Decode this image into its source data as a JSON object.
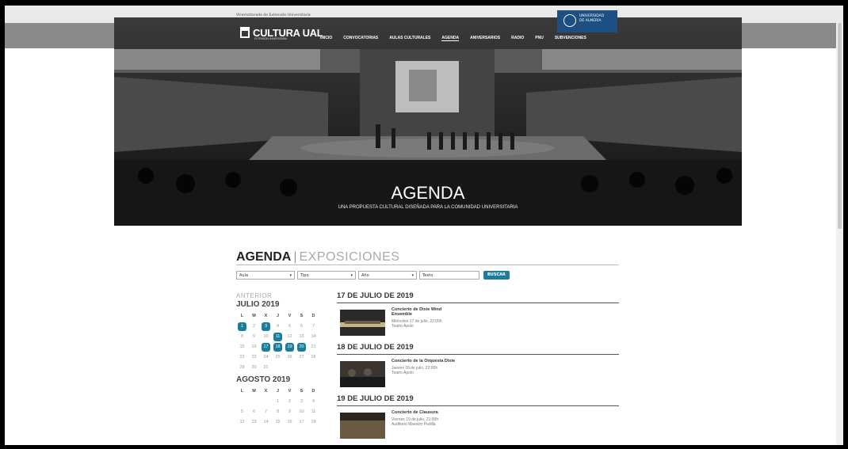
{
  "top_text": "Vicerrectorado de Extensión Universitaria",
  "university": {
    "line1": "UNIVERSIDAD",
    "line2": "DE ALMERÍA"
  },
  "logo": {
    "name": "CULTURA UAL",
    "tagline": "EXTENSIÓN UNIVERSITARIA"
  },
  "nav": [
    {
      "label": "INICIO",
      "active": false
    },
    {
      "label": "CONVOCATORIAS",
      "active": false
    },
    {
      "label": "AULAS CULTURALES",
      "active": false
    },
    {
      "label": "AGENDA",
      "active": true
    },
    {
      "label": "ANIVERSARIOS",
      "active": false
    },
    {
      "label": "RADIO",
      "active": false
    },
    {
      "label": "PNU",
      "active": false
    },
    {
      "label": "SUBVENCIONES",
      "active": false
    }
  ],
  "hero": {
    "title": "AGENDA",
    "subtitle": "UNA PROPUESTA CULTURAL DISEÑADA PARA LA COMUNIDAD UNIVERSITARIA"
  },
  "section": {
    "active": "AGENDA",
    "separator": "|",
    "other": "EXPOSICIONES"
  },
  "filters": [
    {
      "label": "Aula",
      "arrow": "▾"
    },
    {
      "label": "Tipo",
      "arrow": "▾"
    },
    {
      "label": "Año",
      "arrow": "▾"
    }
  ],
  "search": {
    "placeholder": "Texto",
    "button": "BUSCAR"
  },
  "calendar": {
    "prev_label": "ANTERIOR",
    "months": [
      {
        "name": "JULIO 2019",
        "day_names": [
          "L",
          "M",
          "X",
          "J",
          "V",
          "S",
          "D"
        ],
        "days": [
          "1",
          "2",
          "3",
          "4",
          "5",
          "6",
          "7",
          "8",
          "9",
          "10",
          "11",
          "12",
          "13",
          "14",
          "15",
          "16",
          "17",
          "18",
          "19",
          "20",
          "21",
          "22",
          "23",
          "24",
          "25",
          "26",
          "27",
          "28",
          "29",
          "30",
          "31"
        ],
        "offset": 0,
        "highlighted": [
          "1",
          "3",
          "11",
          "17",
          "18",
          "19",
          "20"
        ]
      },
      {
        "name": "AGOSTO 2019",
        "day_names": [
          "L",
          "M",
          "X",
          "J",
          "V",
          "S",
          "D"
        ],
        "days": [
          "1",
          "2",
          "3",
          "4",
          "5",
          "6",
          "7",
          "8",
          "9",
          "10",
          "11",
          "12",
          "13",
          "14",
          "15",
          "16",
          "17",
          "18"
        ],
        "offset": 3,
        "highlighted": []
      }
    ]
  },
  "events": [
    {
      "date": "17 DE JULIO DE 2019",
      "title": "Concierto de Dixie Wind Ensemble",
      "when": "Miércoles 17 de julio, 22:00h",
      "where": "Teatro Apolo"
    },
    {
      "date": "18 DE JULIO DE 2019",
      "title": "Concierto de la Orquesta Dixie",
      "when": "Jueves 18 de julio, 22:00h",
      "where": "Teatro Apolo"
    },
    {
      "date": "19 DE JULIO DE 2019",
      "title": "Concierto de Clausura",
      "when": "Viernes 19 de julio, 21:00h",
      "where": "Auditorio Maestro Padilla"
    }
  ],
  "colors": {
    "accent": "#1a7d9b",
    "university_blue": "#1d4f83"
  }
}
